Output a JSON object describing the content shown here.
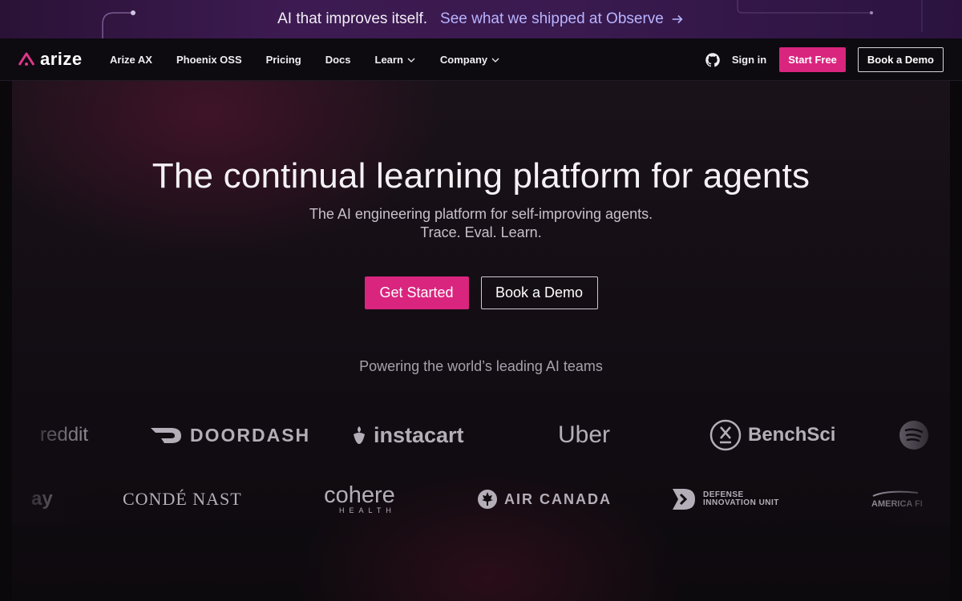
{
  "announcement": {
    "text": "AI that improves itself.",
    "link_text": "See what we shipped at Observe",
    "arrow_icon": "arrow-right-icon"
  },
  "nav": {
    "logo_text": "arize",
    "links": [
      "Arize AX",
      "Phoenix OSS",
      "Pricing",
      "Docs",
      "Learn",
      "Company"
    ],
    "github_icon": "github-icon",
    "signin": "Sign in",
    "start_free": "Start Free",
    "book_demo": "Book a Demo"
  },
  "hero": {
    "title": "The continual learning platform for agents",
    "subtitle_line1": "The AI engineering platform for self-improving agents.",
    "subtitle_line2": "Trace. Eval. Learn.",
    "cta_primary": "Get Started",
    "cta_secondary": "Book a Demo",
    "powering": "Powering the world’s leading AI teams"
  },
  "logos": {
    "row1": [
      "reddit",
      "DOORDASH",
      "instacart",
      "Uber",
      "BenchSci",
      "Spotify"
    ],
    "row2": [
      "ay",
      "CONDÉ NAST",
      "cohere",
      "HEALTH",
      "AIR CANADA",
      "DEFENSE",
      "INNOVATION UNIT",
      "AMERICA FI"
    ]
  },
  "colors": {
    "accent": "#d9257e",
    "announce_link": "#b9b4ff",
    "logo_gray": "#b4aeb8"
  }
}
